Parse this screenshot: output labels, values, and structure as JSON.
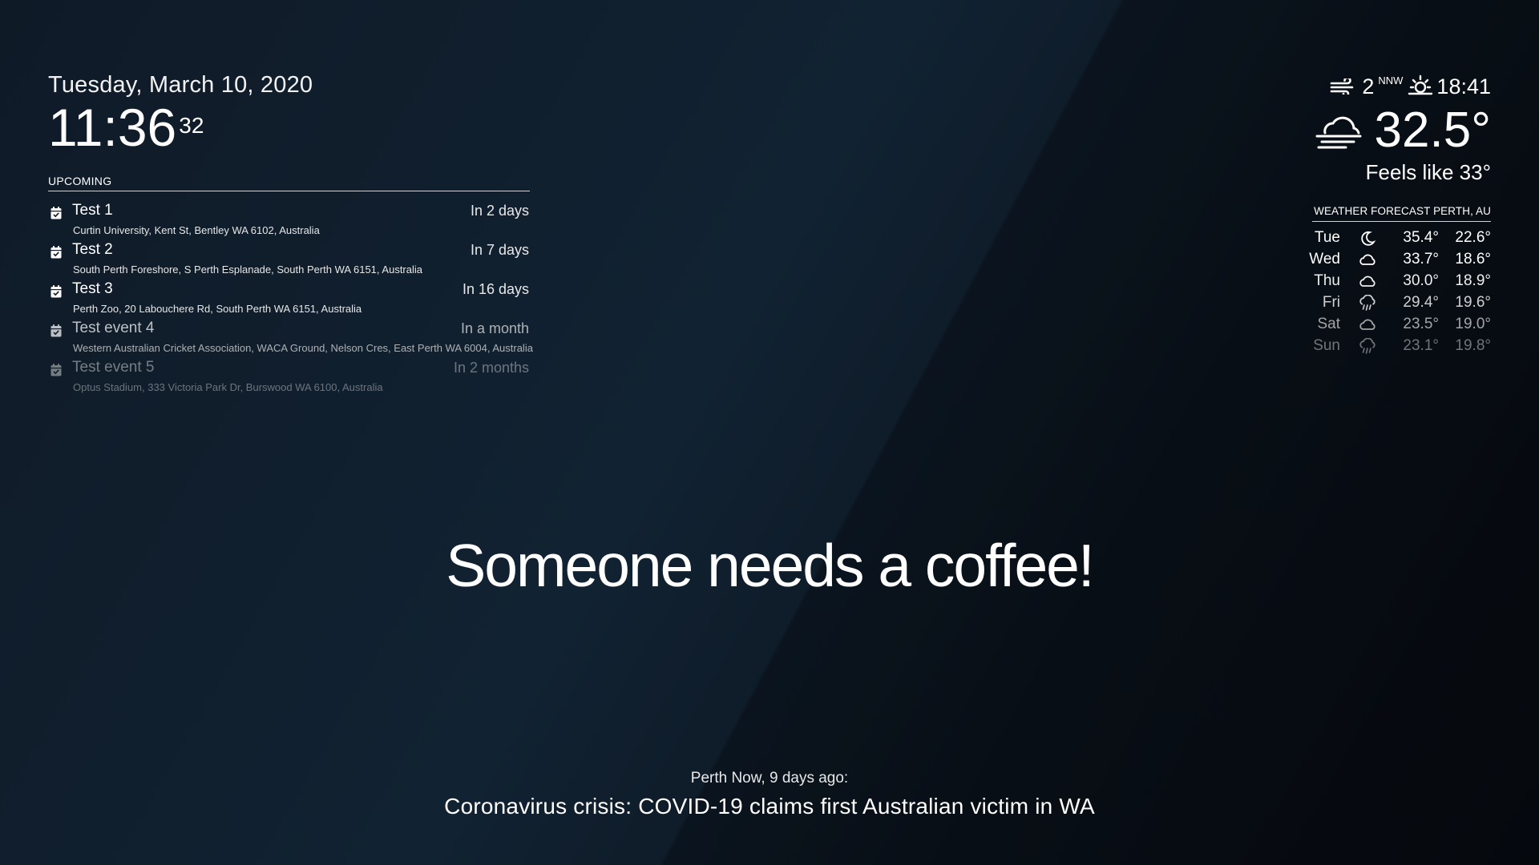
{
  "clock": {
    "date": "Tuesday, March 10, 2020",
    "time": "11:36",
    "seconds": "32"
  },
  "calendar": {
    "header": "UPCOMING",
    "events": [
      {
        "title": "Test 1",
        "relative": "In 2 days",
        "location": "Curtin University, Kent St, Bentley WA 6102, Australia",
        "opacity": 1.0
      },
      {
        "title": "Test 2",
        "relative": "In 7 days",
        "location": "South Perth Foreshore, S Perth Esplanade, South Perth WA 6151, Australia",
        "opacity": 1.0
      },
      {
        "title": "Test 3",
        "relative": "In 16 days",
        "location": "Perth Zoo, 20 Labouchere Rd, South Perth WA 6151, Australia",
        "opacity": 1.0
      },
      {
        "title": "Test event 4",
        "relative": "In a month",
        "location": "Western Australian Cricket Association, WACA Ground, Nelson Cres, East Perth WA 6004, Australia",
        "opacity": 0.72
      },
      {
        "title": "Test event 5",
        "relative": "In 2 months",
        "location": "Optus Stadium, 333 Victoria Park Dr, Burswood WA 6100, Australia",
        "opacity": 0.42
      }
    ]
  },
  "weather": {
    "wind_icon": "wind-icon",
    "wind_speed": "2",
    "wind_direction": "NNW",
    "sun_icon": "sunset-icon",
    "sun_time": "18:41",
    "current_icon": "cloud-wind-icon",
    "temperature": "32.5°",
    "feels_like": "Feels like 33°"
  },
  "forecast": {
    "header": "WEATHER FORECAST PERTH, AU",
    "days": [
      {
        "day": "Tue",
        "icon": "moon-icon",
        "max": "35.4°",
        "min": "22.6°",
        "opacity": 1.0
      },
      {
        "day": "Wed",
        "icon": "cloud-icon",
        "max": "33.7°",
        "min": "18.6°",
        "opacity": 1.0
      },
      {
        "day": "Thu",
        "icon": "cloud-icon",
        "max": "30.0°",
        "min": "18.9°",
        "opacity": 0.93
      },
      {
        "day": "Fri",
        "icon": "rain-icon",
        "max": "29.4°",
        "min": "19.6°",
        "opacity": 0.8
      },
      {
        "day": "Sat",
        "icon": "cloud-icon",
        "max": "23.5°",
        "min": "19.0°",
        "opacity": 0.62
      },
      {
        "day": "Sun",
        "icon": "rain-icon",
        "max": "23.1°",
        "min": "19.8°",
        "opacity": 0.42
      }
    ]
  },
  "compliment": "Someone needs a coffee!",
  "news": {
    "source": "Perth Now, 9 days ago:",
    "headline": "Coronavirus crisis: COVID-19 claims first Australian victim in WA"
  }
}
